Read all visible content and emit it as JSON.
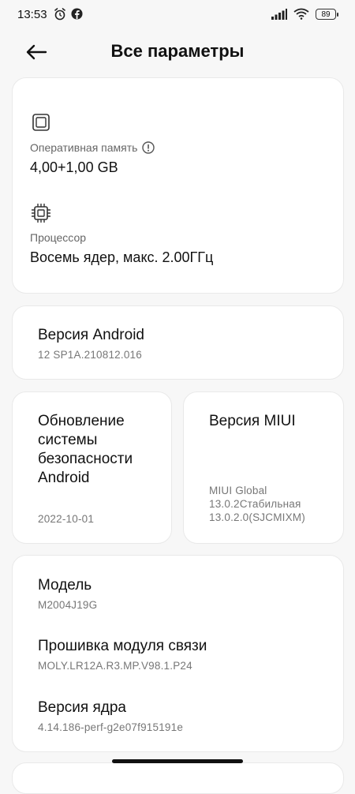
{
  "status_bar": {
    "time": "13:53",
    "battery": "89"
  },
  "header": {
    "title": "Все параметры"
  },
  "hardware": {
    "ram_label": "Оперативная память",
    "ram_value": "4,00+1,00 GB",
    "cpu_label": "Процессор",
    "cpu_value": "Восемь ядер, макс. 2.00ГГц"
  },
  "android": {
    "title": "Версия Android",
    "value": "12 SP1A.210812.016"
  },
  "security": {
    "title_lines": [
      "Обновление",
      "системы",
      "безопасности",
      "Android"
    ],
    "value": "2022-10-01"
  },
  "miui": {
    "title": "Версия MIUI",
    "value_lines": [
      "MIUI Global",
      "13.0.2Стабильная",
      "13.0.2.0(SJCMIXM)"
    ]
  },
  "details": {
    "model_title": "Модель",
    "model_value": "M2004J19G",
    "baseband_title": "Прошивка модуля связи",
    "baseband_value": "MOLY.LR12A.R3.MP.V98.1.P24",
    "kernel_title": "Версия ядра",
    "kernel_value": "4.14.186-perf-g2e07f915191e"
  }
}
